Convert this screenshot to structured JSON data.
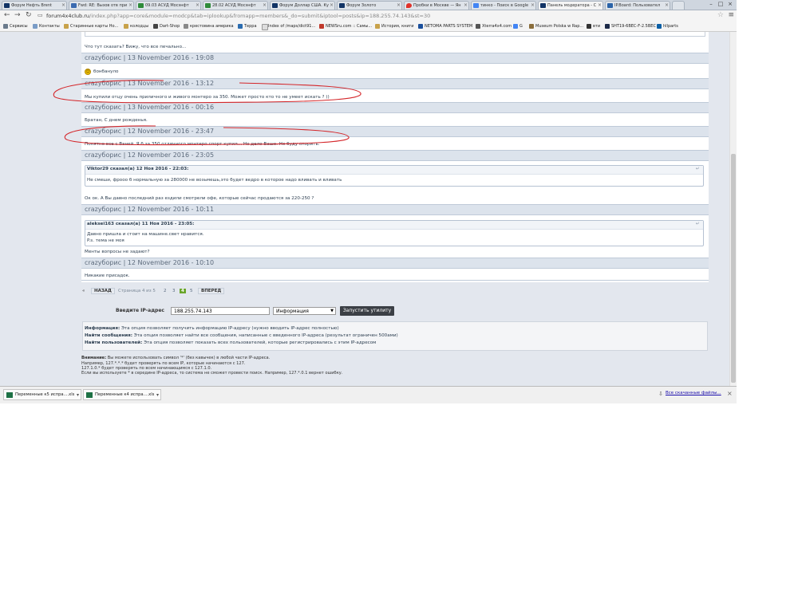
{
  "browser": {
    "tabs": [
      {
        "label": "Форум Нефть Brent"
      },
      {
        "label": "Fwd: RE: Вызов отв при"
      },
      {
        "label": "09.03 АСУД Мосэнфт"
      },
      {
        "label": "28.02 АСУД Мосэнфт"
      },
      {
        "label": "Форум Доллар США. Ку"
      },
      {
        "label": "Форум Золото"
      },
      {
        "label": "Пробки в Москве — Ян"
      },
      {
        "label": "тинко - Поиск в Google"
      },
      {
        "label": "Панель модератора - С"
      },
      {
        "label": "IP.Board: Пользовател"
      }
    ],
    "url_host": "forum4x4club.ru",
    "url_path": "/index.php?app=core&module=modcp&tab=iplookup&fromapp=members&_do=submit&iptool=posts&ip=188.255.74.143&st=30",
    "bookmarks": [
      {
        "label": "Сервисы"
      },
      {
        "label": "Контакты"
      },
      {
        "label": "Старинные карты Но..."
      },
      {
        "label": "колодцы"
      },
      {
        "label": "Dart-Shop"
      },
      {
        "label": "крестовина америка"
      },
      {
        "label": "Терра"
      },
      {
        "label": "Index of /maps/dict91..."
      },
      {
        "label": "NEWSru.com :: Самы..."
      },
      {
        "label": "История, книги"
      },
      {
        "label": "NETOMA PARTS SYSTEM"
      },
      {
        "label": "Xterra4x4.com"
      },
      {
        "label": "G"
      },
      {
        "label": "Museum Polska w Rap..."
      },
      {
        "label": "вти"
      },
      {
        "label": "SHT19-6BEC-F-2.5BEC"
      },
      {
        "label": "hllparts"
      }
    ]
  },
  "posts": [
    {
      "text": "Что тут сказать? Вижу, что все печально..."
    },
    {
      "header": "crazyборис | 13 November 2016 - 19:08",
      "text": "бонбануло"
    },
    {
      "header": "crazyборис | 13 November 2016 - 13:12",
      "text": "Мы купили отцу очень приличного и живого монтеро за 350. Может просто кто то не умеет искать ? ))"
    },
    {
      "header": "crazyборис | 13 November 2016 - 00:16",
      "text": "Братан, С днем рожденья."
    },
    {
      "header": "crazyборис | 12 November 2016 - 23:47",
      "text": "Понятно все с Ваней. Я б за 350 отличного монтеро спорт купил... Но дело Ваше. Не буду спорить."
    },
    {
      "header": "crazyборис | 12 November 2016 - 23:05",
      "quote_author": "Viktor29 сказал(а) 12 Ноя 2016 - 22:03:",
      "quote_text": "Не смеши, фрооо б нормальную за 280000 не возьмешь,это будет ведро в которое надо вливать и вливать",
      "text": "Ок ок. А Вы давно последний раз ездили смотрели офе, которые сейчас продаются за 220-250 ?"
    },
    {
      "header": "crazyборис | 12 November 2016 - 10:11",
      "quote_author": "aleksei163 сказал(а) 11 Ноя 2016 - 23:05:",
      "quote_text": "Давно пришла и стоит на машине.свет нравится.",
      "quote_text2": "P.s. тема не моя",
      "text": "Менты вопросы не задают?"
    },
    {
      "header": "crazyборис | 12 November 2016 - 10:10",
      "text": "Никакие присадок."
    }
  ],
  "pagination": {
    "first": "«",
    "prev": "НАЗАД",
    "info": "Страница 4 из 5",
    "pages": [
      "2",
      "3"
    ],
    "current": "4",
    "next_page": "5",
    "next": "ВПЕРЕД"
  },
  "iptool": {
    "label": "Введите IP-адрес",
    "value": "188.255.74.143",
    "select_value": "Информация",
    "button": "Запустить утилиту"
  },
  "info": [
    {
      "term": "Информация:",
      "desc": "Эта опция позволяет получить информацию IP-адресу (нужно вводить IP-адрес полностью)"
    },
    {
      "term": "Найти сообщения:",
      "desc": "Эта опция позволяет найти все сообщения, написанные с введенного IP-адреса (результат ограничен 500ами)"
    },
    {
      "term": "Найти пользователей:",
      "desc": "Эта опция позволяет показать всех пользователей, которые регистрировались с этим IP-адресом"
    }
  ],
  "note": {
    "title": "Внимание:",
    "line1": "Вы можете использовать символ '*' (без кавычек) в любой части IP-адреса.",
    "line2": "Например, 127.*.*.* будет проверять по всем IP, которые начинаются с 127.",
    "line3": "127.1.0.* будет проверять по всем начинающимся с 127.1.0.",
    "line4": "Если вы используете * в середине IP-адреса, то система не сможет провести поиск. Например, 127.*.0.1 вернет ошибку."
  },
  "downloads": {
    "items": [
      {
        "label": "Переменные к5 испра....xls"
      },
      {
        "label": "Переменные к4 испра....xls"
      }
    ],
    "show_all": "Все скачанные файлы..."
  },
  "colors": {
    "annotation_red": "#d4262a",
    "current_page_green": "#6aa62b",
    "post_header": "#dce3ec"
  }
}
